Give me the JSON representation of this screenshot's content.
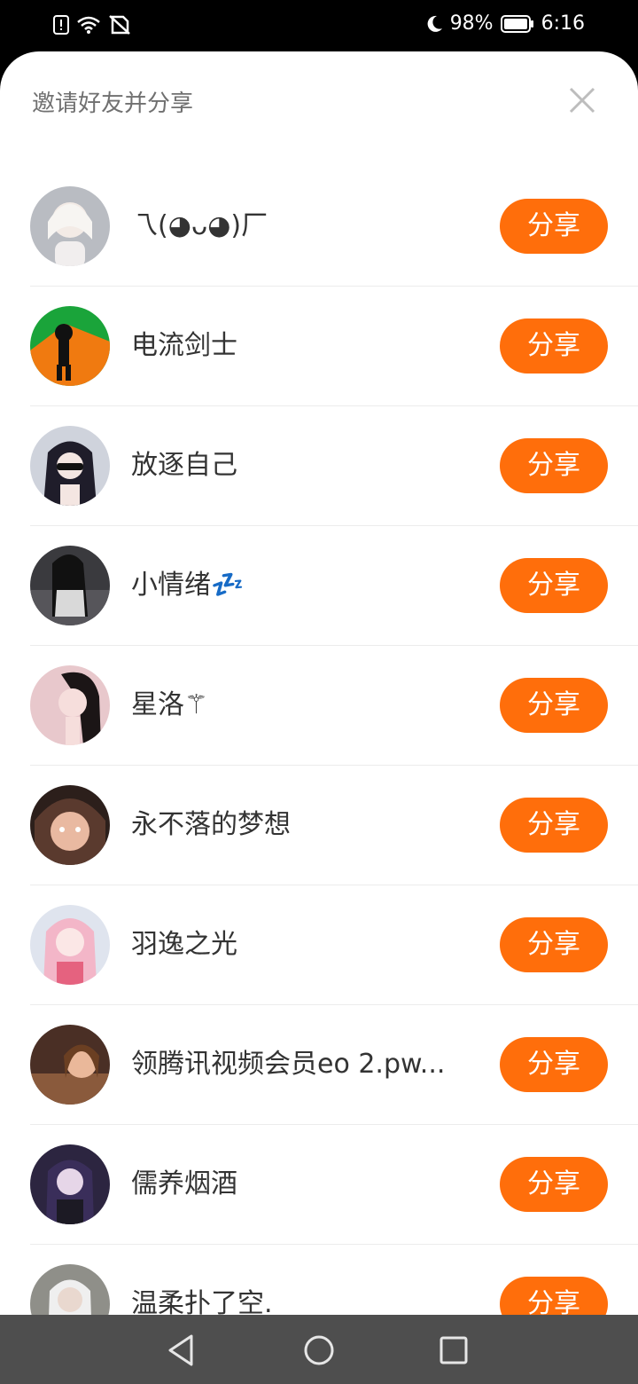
{
  "status_bar": {
    "battery_percent": "98%",
    "time": "6:16",
    "icons": [
      "alert-icon",
      "wifi-icon",
      "no-sim-icon",
      "moon-icon",
      "battery-icon"
    ]
  },
  "sheet": {
    "title": "邀请好友并分享",
    "close_icon": "close-icon"
  },
  "friends": [
    {
      "name": "乁(◕ᴗ◕)厂",
      "share_label": "分享",
      "avatar_color": "#e8e8ea"
    },
    {
      "name": "电流剑士",
      "share_label": "分享",
      "avatar_color": "#1aa43a"
    },
    {
      "name": "放逐自己",
      "share_label": "分享",
      "avatar_color": "#cfd3dc"
    },
    {
      "name": "小情绪💤",
      "share_label": "分享",
      "avatar_color": "#3a3a3e"
    },
    {
      "name": "星洛⚚",
      "share_label": "分享",
      "avatar_color": "#e8c8cc"
    },
    {
      "name": "永不落的梦想",
      "share_label": "分享",
      "avatar_color": "#5a3a2e"
    },
    {
      "name": "羽逸之光",
      "share_label": "分享",
      "avatar_color": "#f3b6c8"
    },
    {
      "name": "领腾讯视频会员eo 2.pw...",
      "share_label": "分享",
      "avatar_color": "#8a5a3c"
    },
    {
      "name": "儒养烟酒",
      "share_label": "分享",
      "avatar_color": "#3a2e5a"
    },
    {
      "name": "温柔扑了空.",
      "share_label": "分享",
      "avatar_color": "#7a7a74"
    }
  ],
  "nav_bar": {
    "icons": [
      "back-icon",
      "home-icon",
      "recents-icon"
    ]
  },
  "colors": {
    "accent": "#ff6e0b",
    "nav_bg": "#4e4e4e"
  }
}
